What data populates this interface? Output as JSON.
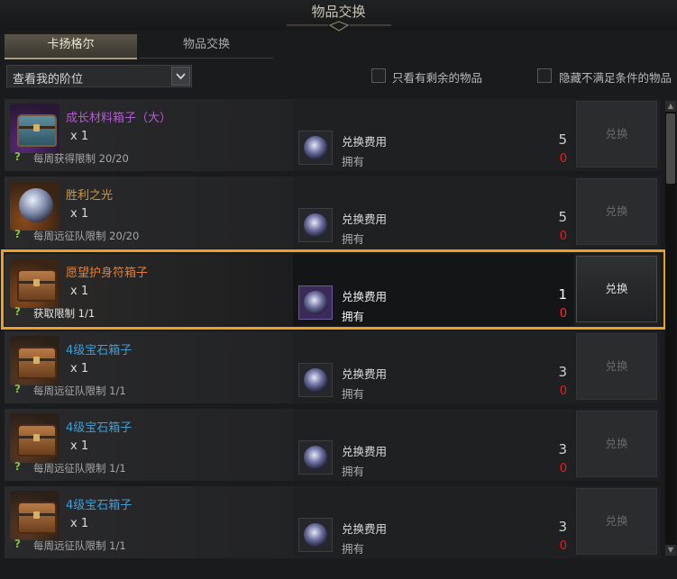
{
  "window": {
    "title": "物品交换"
  },
  "tabs": [
    {
      "label": "卡扬格尔"
    },
    {
      "label": "物品交换"
    }
  ],
  "filter": {
    "label": "查看我的阶位"
  },
  "options": {
    "only_remaining": "只看有剩余的物品",
    "hide_unmet": "隐藏不满足条件的物品"
  },
  "cost_label": "兑换费用",
  "own_label": "拥有",
  "exchange_label": "兑换",
  "items": [
    {
      "name": "成长材料箱子（大）",
      "qty": "x 1",
      "limit": "每周获得限制 20/20",
      "cost": "5",
      "owned": "0",
      "name_color": "purple",
      "icon": "teal-chest-icon"
    },
    {
      "name": "胜利之光",
      "qty": "x 1",
      "limit": "每周远征队限制 20/20",
      "cost": "5",
      "owned": "0",
      "name_color": "gold",
      "icon": "light-orb-icon"
    },
    {
      "name": "愿望护身符箱子",
      "qty": "x 1",
      "limit": "获取限制 1/1",
      "cost": "1",
      "owned": "0",
      "name_color": "orange",
      "icon": "wooden-chest-icon",
      "highlighted": true
    },
    {
      "name": "4级宝石箱子",
      "qty": "x 1",
      "limit": "每周远征队限制 1/1",
      "cost": "3",
      "owned": "0",
      "name_color": "blue",
      "icon": "wooden-chest-icon"
    },
    {
      "name": "4级宝石箱子",
      "qty": "x 1",
      "limit": "每周远征队限制 1/1",
      "cost": "3",
      "owned": "0",
      "name_color": "blue",
      "icon": "wooden-chest-icon"
    },
    {
      "name": "4级宝石箱子",
      "qty": "x 1",
      "limit": "每周远征队限制 1/1",
      "cost": "3",
      "owned": "0",
      "name_color": "blue",
      "icon": "wooden-chest-icon"
    }
  ],
  "colors": {
    "highlight": "#f0a020",
    "owned_red": "#e02020",
    "limit_green": "#7ec23e"
  }
}
